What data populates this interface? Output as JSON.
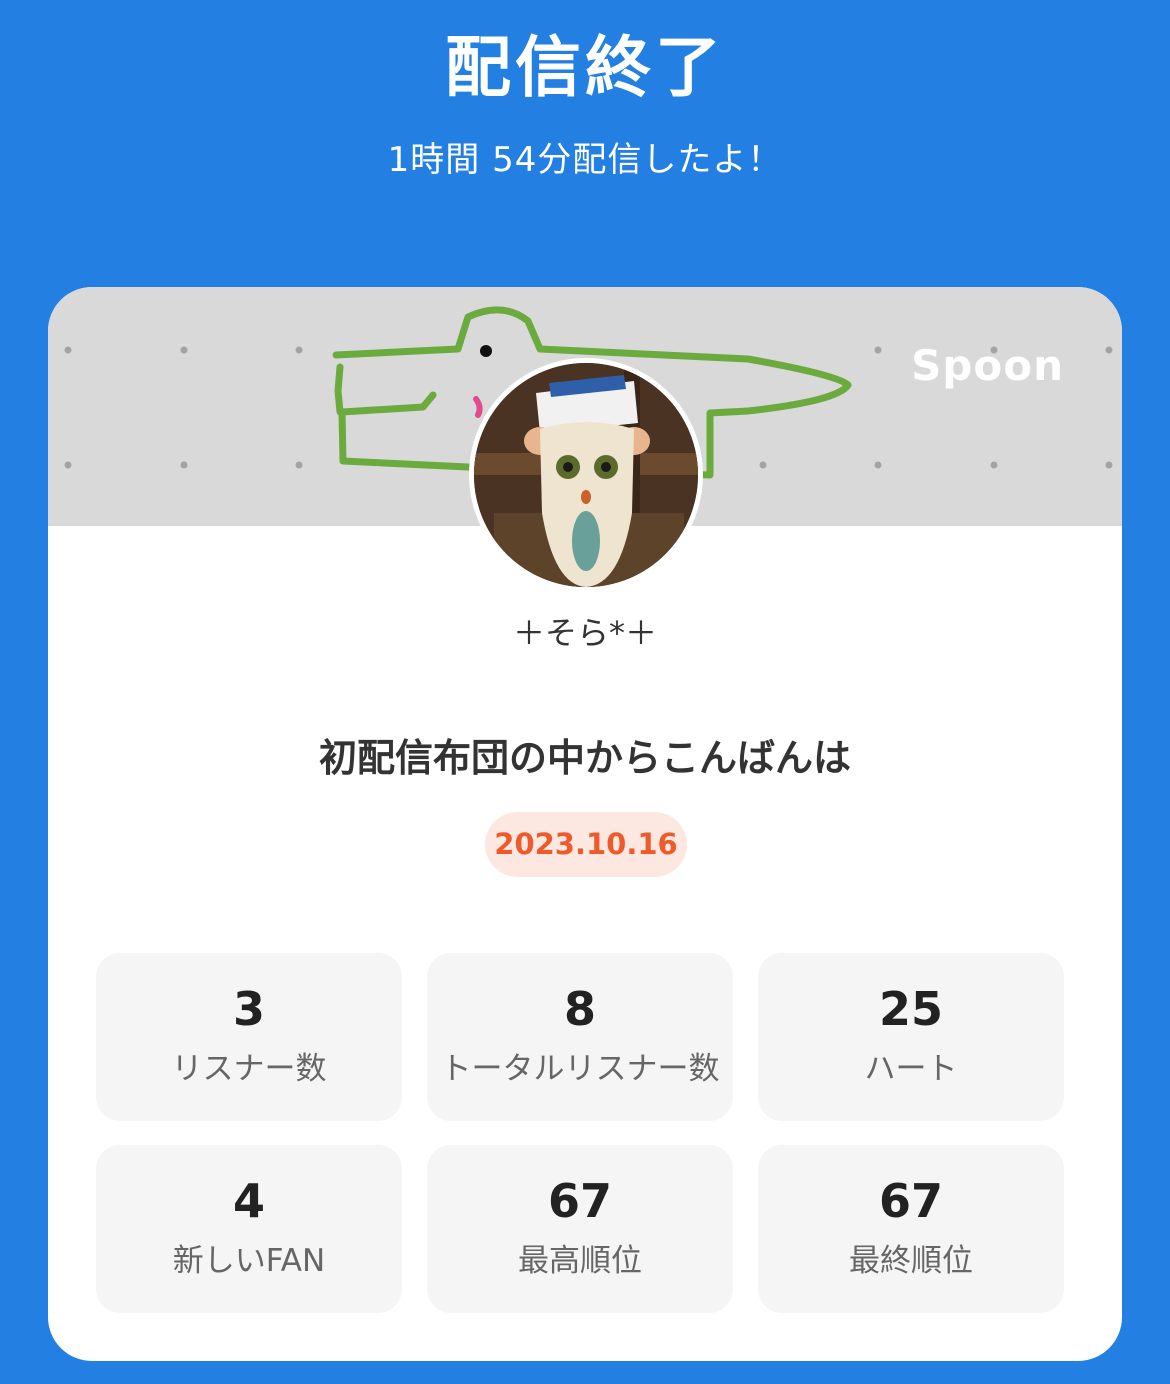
{
  "header": {
    "title": "配信終了",
    "subtitle": "1時間 54分配信したよ！"
  },
  "card": {
    "brand": "Spoon",
    "username": "＋そら*＋",
    "show_title": "初配信布団の中からこんばんは",
    "date": "2023.10.16"
  },
  "stats": [
    {
      "value": "3",
      "label": "リスナー数"
    },
    {
      "value": "8",
      "label": "トータルリスナー数"
    },
    {
      "value": "25",
      "label": "ハート"
    },
    {
      "value": "4",
      "label": "新しいFAN"
    },
    {
      "value": "67",
      "label": "最高順位"
    },
    {
      "value": "67",
      "label": "最終順位"
    }
  ],
  "colors": {
    "background": "#247fe3",
    "banner": "#d9d9d9",
    "doodle": "#6bab3e",
    "date_text": "#ef5a2a",
    "date_bg": "#fde8e1"
  }
}
